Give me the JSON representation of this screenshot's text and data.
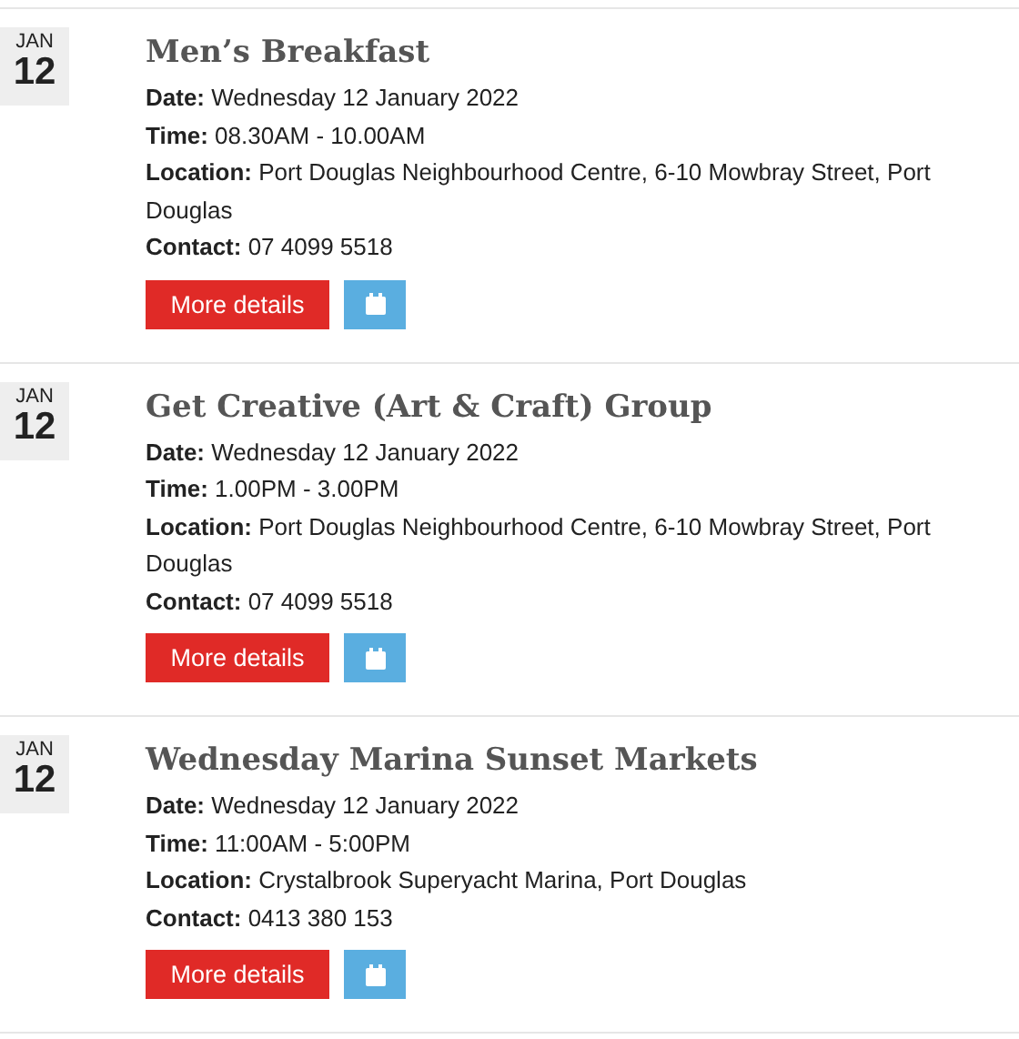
{
  "events": [
    {
      "month": "JAN",
      "day": "12",
      "title": "Men’s Breakfast",
      "details": [
        "**Date:** Wednesday 12 January 2022",
        "**Time:** 08.30AM - 10.00AM",
        "**Location:** Port Douglas Neighbourhood Centre, 6-10 Mowbray Street, Port Douglas",
        "**Contact:** 07 4099 5518"
      ],
      "button": "More details"
    },
    {
      "month": "JAN",
      "day": "12",
      "title": "Get Creative (Art & Craft) Group",
      "details": [
        "**Date:** Wednesday 12 January 2022",
        "**Time:** 1.00PM - 3.00PM",
        "**Location:** Port Douglas Neighbourhood Centre, 6-10 Mowbray Street, Port Douglas",
        "**Contact:** 07 4099 5518"
      ],
      "button": "More details"
    },
    {
      "month": "JAN",
      "day": "12",
      "title": "Wednesday Marina Sunset Markets",
      "details": [
        "**Date:** Wednesday 12 January 2022",
        "**Time:** 11:00AM - 5:00PM",
        "**Location:** Crystalbrook Superyacht Marina, Port Douglas",
        "**Contact:** 0413 380 153"
      ],
      "button": "More details"
    }
  ]
}
